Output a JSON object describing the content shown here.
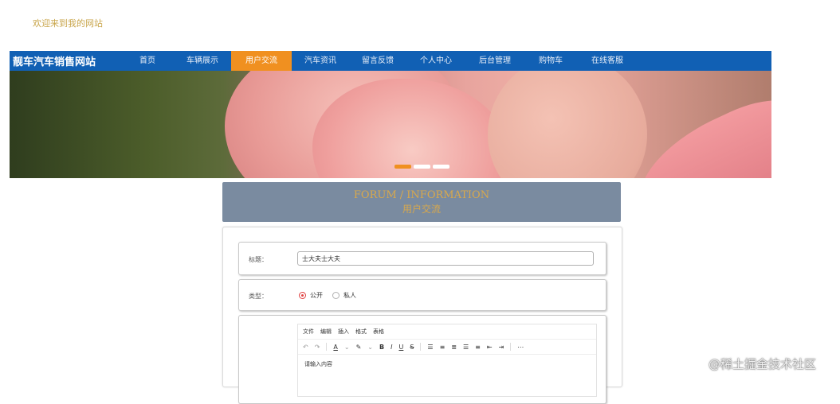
{
  "welcome": "欢迎来到我的网站",
  "nav": {
    "brand": "靓车汽车销售网站",
    "items": [
      {
        "label": "首页"
      },
      {
        "label": "车辆展示"
      },
      {
        "label": "用户交流"
      },
      {
        "label": "汽车资讯"
      },
      {
        "label": "留言反馈"
      },
      {
        "label": "个人中心"
      },
      {
        "label": "后台管理"
      },
      {
        "label": "购物车"
      },
      {
        "label": "在线客服"
      }
    ],
    "active_index": 2,
    "bg_color": "#1160b4",
    "active_color": "#f09020"
  },
  "banner": {
    "slide_count": 3,
    "active_slide": 0
  },
  "forum_header": {
    "title_en": "FORUM / INFORMATION",
    "title_cn": "用户交流"
  },
  "form": {
    "title_label": "标题：",
    "title_value": "士大夫士大夫",
    "type_label": "类型：",
    "type_options": [
      {
        "label": "公开",
        "checked": true
      },
      {
        "label": "私人",
        "checked": false
      }
    ],
    "editor": {
      "menu": [
        "文件",
        "编辑",
        "插入",
        "格式",
        "表格"
      ],
      "placeholder": "请输入内容"
    }
  },
  "watermark": "@稀土掘金技术社区"
}
